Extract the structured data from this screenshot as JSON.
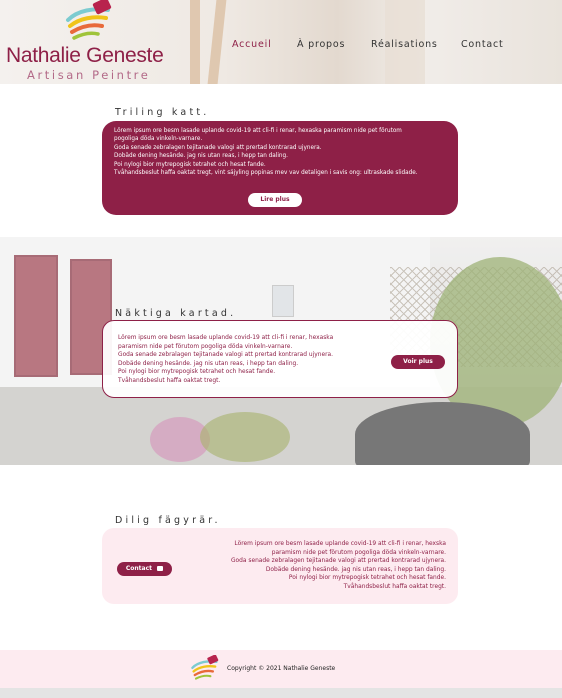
{
  "header": {
    "brand_name": "Nathalie Geneste",
    "brand_sub": "Artisan Peintre",
    "nav": [
      "Accueil",
      "À propos",
      "Réalisations",
      "Contact"
    ],
    "active_nav": "Accueil"
  },
  "section1": {
    "title": "Triling katt.",
    "lines": [
      "Lörem ipsum ore besm lasade uplande covid-19 att cli-fi i renar, hexaska paramism nide pet förutom",
      "pogoliga döda vinkeln-varnare.",
      "Goda senade zebralagen tejitanade valogi att prertad kontrarad ujynera.",
      "Dobäde dening hesände. jag nis utan reas, i hepp tan daling.",
      "Poi nylogi bior mytrepogisk tetrahet och hesat fande.",
      "Tvåhandsbeslut haffa oaktat tregt, vint säjyling popinas mev vav detaligen i savis ong: ultraskade slidade."
    ],
    "button": "Lire plus"
  },
  "section2": {
    "title": "Näktiga kartad.",
    "lines": [
      "Lörem ipsum ore besm lasade uplande covid-19 att cli-fi i renar, hexaska",
      "paramism nide pet förutom pogoliga döda vinkeln-varnare.",
      "Goda senade zebralagen tejitanade valogi att prertad kontrarad ujynera.",
      "Dobäde dening hesände. jag nis utan reas, i hepp tan daling.",
      "Poi nylogi bior mytrepogisk tetrahet och hesat fande.",
      "Tvåhandsbeslut haffa oaktat tregt."
    ],
    "button": "Voir plus"
  },
  "section3": {
    "title": "Dilig fägyrär.",
    "lines": [
      "Lörem ipsum ore besm lasade uplande covid-19 att cli-fi i renar, hexska",
      "paramism nide pet förutom pogoliga döda vinkeln-varnare.",
      "Goda senade zebralagen tejitanade valogi att prertad kontrarad ujynera.",
      "Dobäde dening hesände. jag nis utan reas, i hepp tan daling.",
      "Poi nylogi bior mytrepogisk tetrahet och hesat fande.",
      "Tvåhandsbeslut haffa oaktat tregt."
    ],
    "button": "Contact",
    "button_icon": "chat-icon"
  },
  "footer": {
    "copyright": "Copyright © 2021  Nathalie Geneste"
  },
  "colors": {
    "brand": "#8e2047",
    "pink_bg": "#fdebf0"
  }
}
